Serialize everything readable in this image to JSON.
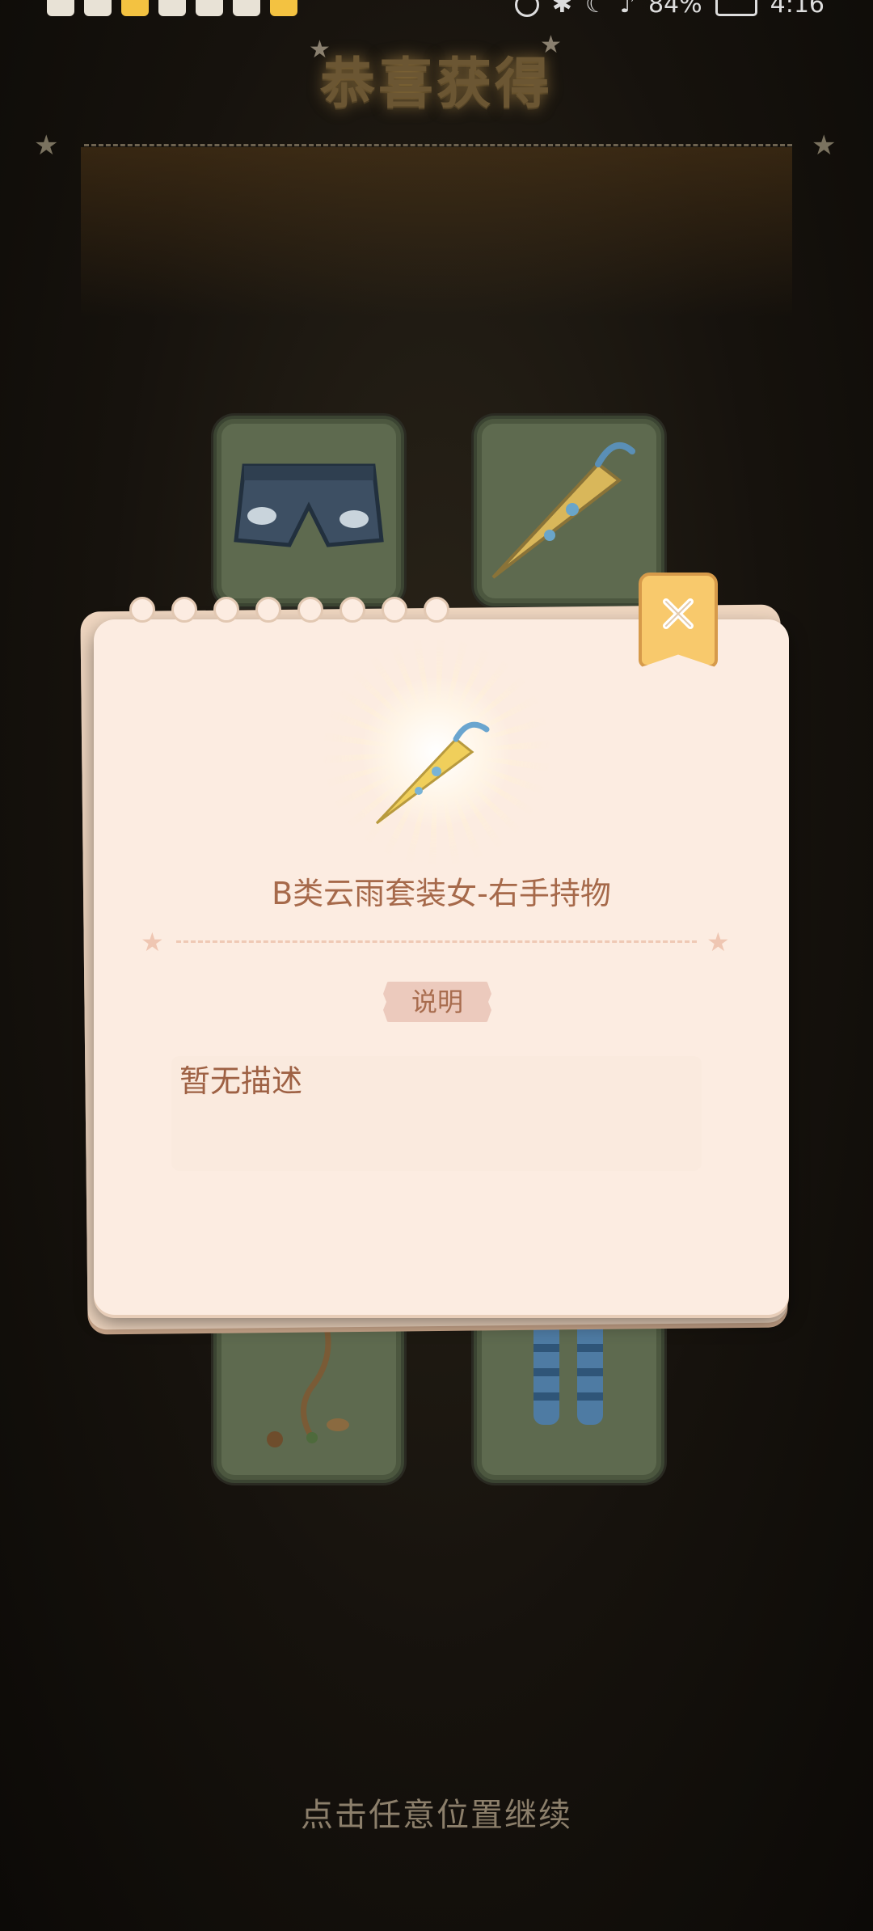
{
  "status_bar": {
    "battery": "84%",
    "time": "4:16"
  },
  "header": {
    "title": "恭喜获得"
  },
  "reward_items": [
    {
      "icon": "denim-shorts-icon"
    },
    {
      "icon": "umbrella-icon"
    },
    {
      "icon": "vine-accessory-icon"
    },
    {
      "icon": "striped-stockings-icon"
    }
  ],
  "modal": {
    "item_name": "B类云雨套装女-右手持物",
    "item_icon": "umbrella-icon",
    "description_label": "说明",
    "description_text": "暂无描述",
    "close_icon": "close-icon"
  },
  "footer": {
    "continue_hint": "点击任意位置继续"
  },
  "colors": {
    "modal_bg": "#fcece1",
    "close_button": "#f8c96c",
    "text_brown": "#a6694a",
    "card_bg": "#5e6a4f"
  }
}
